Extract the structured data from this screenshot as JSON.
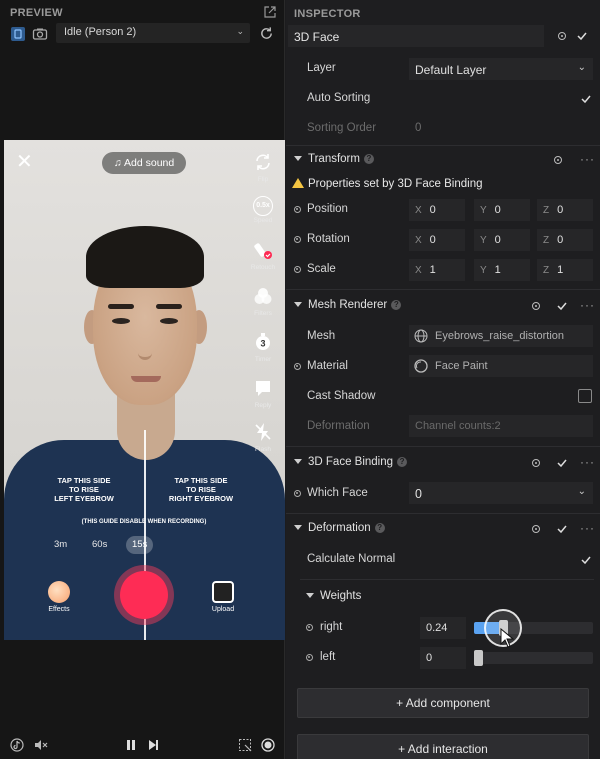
{
  "preview": {
    "title": "PREVIEW",
    "mode_select": "Idle (Person 2)",
    "phone": {
      "add_sound": "Add sound",
      "tools": [
        {
          "label": "Flip",
          "icon": "flip-icon"
        },
        {
          "label": "Speed",
          "icon": "speed-icon",
          "badge": "0.5x"
        },
        {
          "label": "Retouch",
          "icon": "retouch-icon"
        },
        {
          "label": "Filters",
          "icon": "filters-icon"
        },
        {
          "label": "Timer",
          "icon": "timer-icon",
          "badge": "3"
        },
        {
          "label": "Reply",
          "icon": "reply-icon"
        },
        {
          "label": "Flash",
          "icon": "flash-icon"
        }
      ],
      "guide_left": "TAP THIS SIDE\nTO RISE\nLEFT EYEBROW",
      "guide_right": "TAP THIS SIDE\nTO RISE\nRIGHT EYEBROW",
      "guide_note": "(THIS GUIDE DISABLE WHEN RECORDING)",
      "durations": [
        "3m",
        "60s",
        "15s"
      ],
      "active_duration": "15s",
      "effects_label": "Effects",
      "upload_label": "Upload"
    }
  },
  "inspector": {
    "title": "INSPECTOR",
    "object_name": "3D Face",
    "layer_label": "Layer",
    "layer_value": "Default Layer",
    "auto_sorting_label": "Auto Sorting",
    "sorting_order_label": "Sorting Order",
    "sorting_order_value": "0",
    "transform": {
      "title": "Transform",
      "warning": "Properties set by 3D Face Binding",
      "rows": [
        {
          "label": "Position",
          "x": "0",
          "y": "0",
          "z": "0"
        },
        {
          "label": "Rotation",
          "x": "0",
          "y": "0",
          "z": "0"
        },
        {
          "label": "Scale",
          "x": "1",
          "y": "1",
          "z": "1"
        }
      ],
      "axis_x": "X",
      "axis_y": "Y",
      "axis_z": "Z"
    },
    "mesh_renderer": {
      "title": "Mesh Renderer",
      "mesh_label": "Mesh",
      "mesh_value": "Eyebrows_raise_distortion",
      "material_label": "Material",
      "material_value": "Face Paint",
      "cast_shadow_label": "Cast Shadow",
      "deformation_label": "Deformation",
      "deformation_value": "Channel counts:2"
    },
    "face_binding": {
      "title": "3D Face Binding",
      "which_face_label": "Which Face",
      "which_face_value": "0"
    },
    "deformation": {
      "title": "Deformation",
      "calc_normal_label": "Calculate Normal",
      "weights_label": "Weights",
      "weights": [
        {
          "label": "right",
          "value": "0.24",
          "level": 0.24
        },
        {
          "label": "left",
          "value": "0",
          "level": 0
        }
      ]
    },
    "add_component": "+ Add component",
    "add_interaction": "+ Add interaction"
  },
  "colors": {
    "accent": "#5aa2f0",
    "record": "#fe2c55",
    "warning": "#f5c542"
  }
}
